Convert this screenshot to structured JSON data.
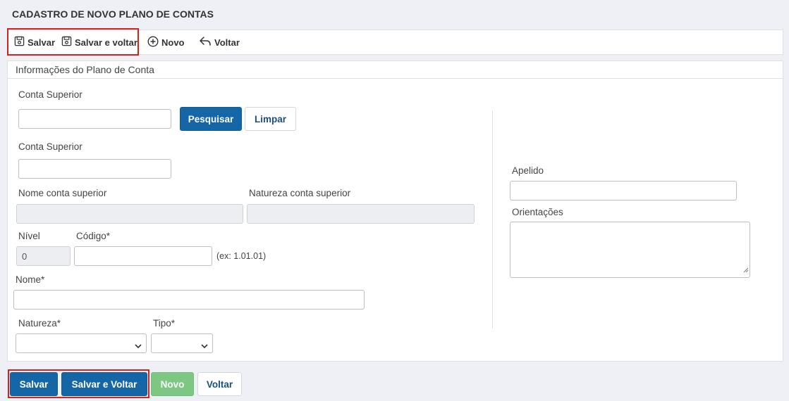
{
  "page_title": "CADASTRO DE NOVO PLANO DE CONTAS",
  "toolbar": {
    "save_label": "Salvar",
    "save_back_label": "Salvar e voltar",
    "new_label": "Novo",
    "back_label": "Voltar"
  },
  "panel": {
    "title": "Informações do Plano de Conta"
  },
  "form": {
    "parent_account_search_label": "Conta Superior",
    "parent_account_search_value": "",
    "search_button": "Pesquisar",
    "clear_button": "Limpar",
    "parent_account_label": "Conta Superior",
    "parent_account_value": "",
    "parent_name_label": "Nome conta superior",
    "parent_name_value": "",
    "parent_nature_label": "Natureza conta superior",
    "parent_nature_value": "",
    "level_label": "Nível",
    "level_value": "0",
    "code_label": "Código*",
    "code_value": "",
    "code_hint": "(ex: 1.01.01)",
    "name_label": "Nome*",
    "name_value": "",
    "nature_label": "Natureza*",
    "nature_selected": "",
    "type_label": "Tipo*",
    "type_selected": "",
    "nickname_label": "Apelido",
    "nickname_value": "",
    "guidance_label": "Orientações",
    "guidance_value": ""
  },
  "footer": {
    "save_label": "Salvar",
    "save_back_label": "Salvar e Voltar",
    "new_label": "Novo",
    "back_label": "Voltar"
  },
  "colors": {
    "primary": "#1466a7",
    "success": "#7ec783",
    "highlight": "#d9201f",
    "background": "#eef0f5"
  }
}
